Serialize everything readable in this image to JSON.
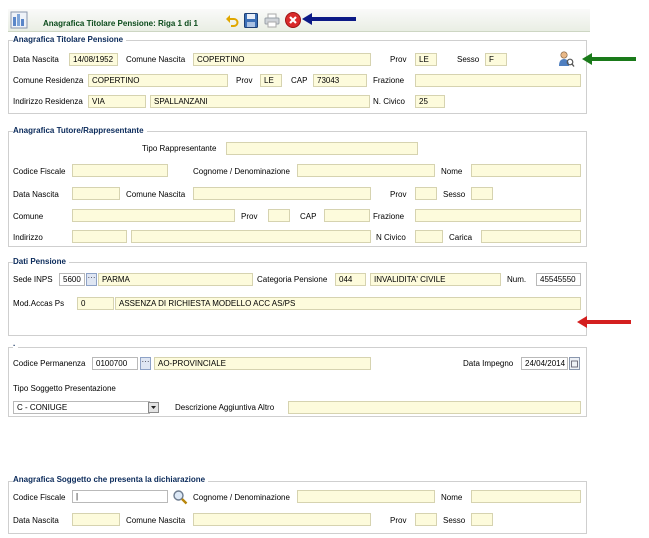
{
  "toolbar": {
    "title": "Anagrafica Titolare Pensione: Riga 1 di 1"
  },
  "titolare": {
    "title": "Anagrafica Titolare Pensione",
    "data_nascita_label": "Data Nascita",
    "data_nascita": "14/08/1952",
    "comune_nascita_label": "Comune Nascita",
    "comune_nascita": "COPERTINO",
    "prov_label": "Prov",
    "prov": "LE",
    "sesso_label": "Sesso",
    "sesso": "F",
    "comune_residenza_label": "Comune Residenza",
    "comune_residenza": "COPERTINO",
    "prov2_label": "Prov",
    "prov2": "LE",
    "cap_label": "CAP",
    "cap": "73043",
    "frazione_label": "Frazione",
    "frazione": "",
    "indirizzo_label": "Indirizzo Residenza",
    "indirizzo_tipo": "VIA",
    "indirizzo_nome": "SPALLANZANI",
    "civico_label": "N. Civico",
    "civico": "25"
  },
  "tutore": {
    "title": "Anagrafica Tutore/Rappresentante",
    "tipo_label": "Tipo Rappresentante",
    "codice_fiscale_label": "Codice Fiscale",
    "cognome_label": "Cognome / Denominazione",
    "nome_label": "Nome",
    "data_nascita_label": "Data Nascita",
    "comune_nascita_label": "Comune Nascita",
    "prov_label": "Prov",
    "sesso_label": "Sesso",
    "comune_label": "Comune",
    "prov2_label": "Prov",
    "cap_label": "CAP",
    "frazione_label": "Frazione",
    "indirizzo_label": "Indirizzo",
    "civico_label": "N Civico",
    "carica_label": "Carica"
  },
  "pensione": {
    "title": "Dati Pensione",
    "sede_label": "Sede INPS",
    "sede_code": "5600",
    "sede_name": "PARMA",
    "categoria_label": "Categoria Pensione",
    "categoria_code": "044",
    "categoria_name": "INVALIDITA' CIVILE",
    "num_label": "Num.",
    "num": "45545550",
    "mod_label": "Mod.Accas Ps",
    "mod_code": "0",
    "mod_desc": "ASSENZA DI RICHIESTA MODELLO ACC AS/PS"
  },
  "permanenza": {
    "dot": ".",
    "codice_label": "Codice Permanenza",
    "codice": "0100700",
    "codice_desc": "AO-PROVINCIALE",
    "data_impegno_label": "Data Impegno",
    "data_impegno": "24/04/2014",
    "tipo_label": "Tipo Soggetto Presentazione",
    "tipo_value": "C - CONIUGE",
    "desc_label": "Descrizione Aggiuntiva Altro"
  },
  "soggetto": {
    "title": "Anagrafica Soggetto che presenta la dichiarazione",
    "codice_fiscale_label": "Codice Fiscale",
    "cognome_label": "Cognome / Denominazione",
    "nome_label": "Nome",
    "data_nascita_label": "Data Nascita",
    "comune_nascita_label": "Comune Nascita",
    "prov_label": "Prov",
    "sesso_label": "Sesso"
  },
  "colors": {
    "field_bg": "#fdfbdc",
    "arrow_blue": "#0c1a86",
    "arrow_green": "#1a7a1a",
    "arrow_red": "#d41f1f",
    "close_red": "#d92b2b"
  }
}
